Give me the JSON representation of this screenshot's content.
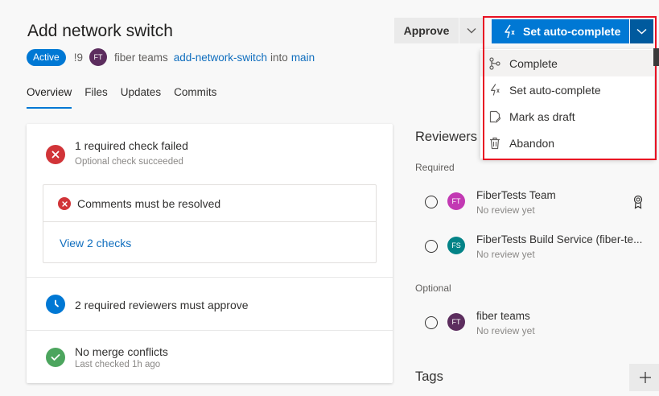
{
  "pr": {
    "title": "Add network switch",
    "status": "Active",
    "id": "!9",
    "author_initials": "FT",
    "author": "fiber teams",
    "source_branch": "add-network-switch",
    "into": "into",
    "target_branch": "main"
  },
  "tabs": [
    {
      "label": "Overview"
    },
    {
      "label": "Files"
    },
    {
      "label": "Updates"
    },
    {
      "label": "Commits"
    }
  ],
  "checks": {
    "required": {
      "title": "1 required check failed",
      "subtitle": "Optional check succeeded"
    },
    "comments": {
      "title": "Comments must be resolved"
    },
    "view_checks": "View 2 checks",
    "reviewers_required": {
      "title": "2 required reviewers must approve"
    },
    "merge": {
      "title": "No merge conflicts",
      "subtitle": "Last checked 1h ago"
    }
  },
  "actions": {
    "approve": "Approve",
    "auto_complete": "Set auto-complete",
    "menu": [
      {
        "label": "Complete",
        "icon": "merge-icon"
      },
      {
        "label": "Set auto-complete",
        "icon": "auto-complete-icon"
      },
      {
        "label": "Mark as draft",
        "icon": "draft-icon"
      },
      {
        "label": "Abandon",
        "icon": "trash-icon"
      }
    ]
  },
  "reviewers": {
    "title": "Reviewers",
    "required_label": "Required",
    "optional_label": "Optional",
    "required": [
      {
        "initials": "FT",
        "name": "FiberTests Team",
        "status": "No review yet",
        "color": "#c239b3"
      },
      {
        "initials": "FS",
        "name": "FiberTests Build Service (fiber-te...",
        "status": "No review yet",
        "color": "#038387"
      }
    ],
    "optional": [
      {
        "initials": "FT",
        "name": "fiber teams",
        "status": "No review yet",
        "color": "#5c2d5e"
      }
    ]
  },
  "tags": {
    "title": "Tags",
    "add_icon": "plus-icon"
  },
  "colors": {
    "accent": "#0078d4",
    "error": "#d13438",
    "success": "#4ca55e",
    "highlight": "#e81123"
  }
}
